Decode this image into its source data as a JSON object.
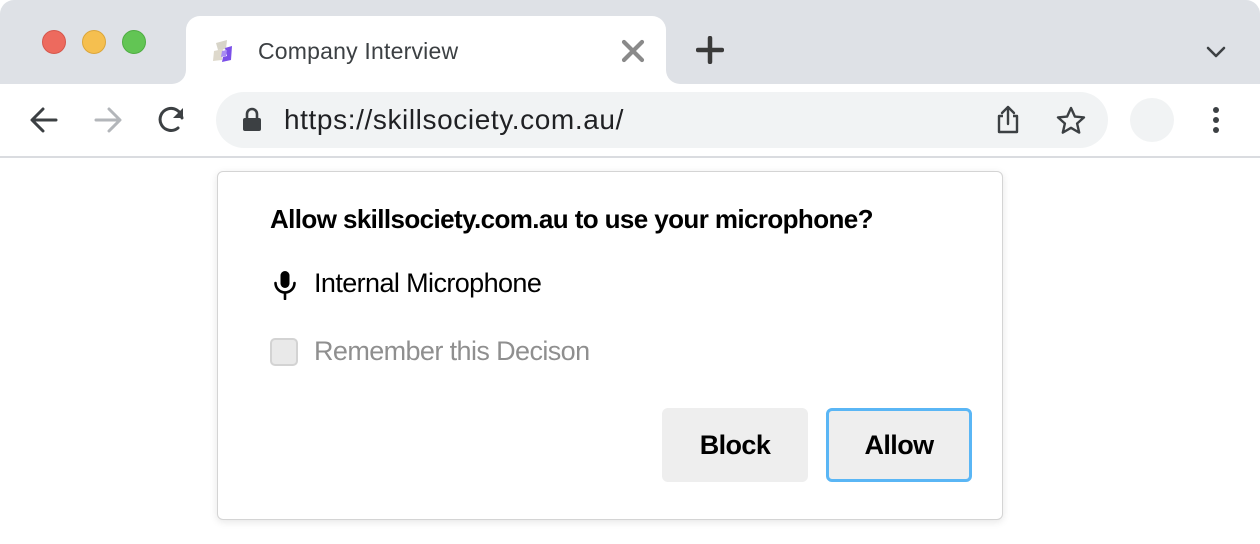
{
  "window": {
    "controls": [
      "close",
      "minimize",
      "maximize"
    ],
    "colors": {
      "close": "#ed6a5e",
      "minimize": "#f5bf4f",
      "maximize": "#62c554"
    }
  },
  "tab": {
    "title": "Company Interview",
    "favicon": "skillsociety-logo-icon",
    "close_icon": "close-icon"
  },
  "tabstrip": {
    "new_tab_icon": "plus-icon",
    "tab_search_icon": "chevron-down-icon"
  },
  "toolbar": {
    "back_icon": "arrow-left-icon",
    "forward_icon": "arrow-right-icon",
    "reload_icon": "reload-icon",
    "url": "https://skillsociety.com.au/",
    "lock_icon": "lock-icon",
    "share_icon": "share-icon",
    "bookmark_icon": "star-icon",
    "menu_icon": "more-vertical-icon"
  },
  "dialog": {
    "title": "Allow skillsociety.com.au to use your microphone?",
    "device_icon": "microphone-icon",
    "device_label": "Internal Microphone",
    "remember_label": "Remember this Decison",
    "remember_checked": false,
    "block_label": "Block",
    "allow_label": "Allow",
    "focus_color": "#5ab6f5"
  }
}
